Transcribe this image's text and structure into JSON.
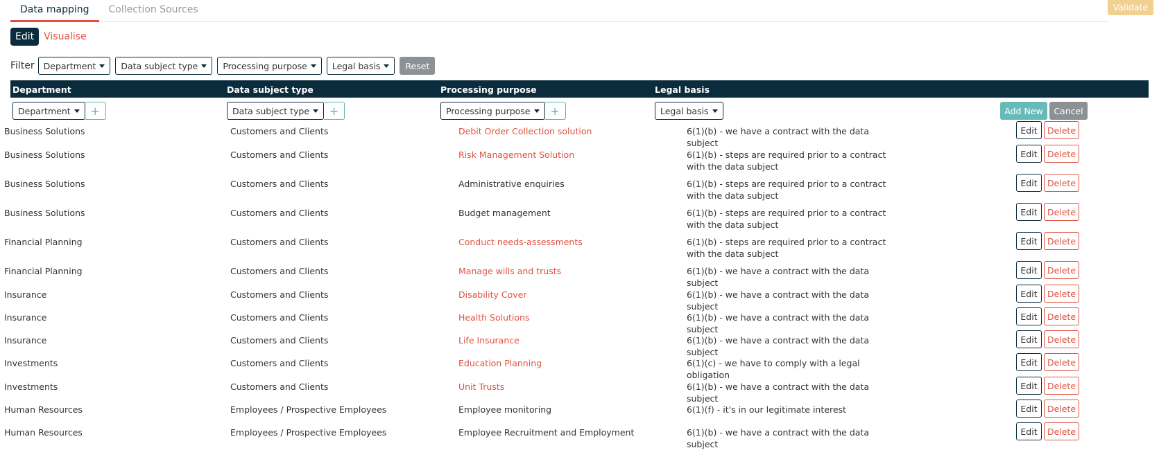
{
  "tabs": [
    {
      "label": "Data mapping",
      "active": true
    },
    {
      "label": "Collection Sources",
      "active": false
    }
  ],
  "validate_label": "Validate",
  "mode": {
    "edit": "Edit",
    "visualise": "Visualise"
  },
  "filter": {
    "label": "Filter",
    "dropdowns": [
      "Department",
      "Data subject type",
      "Processing purpose",
      "Legal basis"
    ],
    "reset": "Reset"
  },
  "table": {
    "headers": [
      "Department",
      "Data subject type",
      "Processing purpose",
      "Legal basis"
    ],
    "add_row": {
      "department": "Department",
      "subject_type": "Data subject type",
      "purpose": "Processing purpose",
      "legal_basis": "Legal basis",
      "plus": "+",
      "add_new": "Add New",
      "cancel": "Cancel"
    },
    "row_actions": {
      "edit": "Edit",
      "delete": "Delete"
    },
    "rows": [
      {
        "department": "Business Solutions",
        "subject_type": "Customers and Clients",
        "purpose": "Debit Order Collection solution",
        "purpose_link": true,
        "legal_basis": "6(1)(b) - we have a contract with the data subject"
      },
      {
        "department": "Business Solutions",
        "subject_type": "Customers and Clients",
        "purpose": "Risk Management Solution",
        "purpose_link": true,
        "legal_basis": "6(1)(b) - steps are required prior to a contract with the data subject"
      },
      {
        "department": "Business Solutions",
        "subject_type": "Customers and Clients",
        "purpose": "Administrative enquiries",
        "purpose_link": false,
        "legal_basis": "6(1)(b) - steps are required prior to a contract with the data subject"
      },
      {
        "department": "Business Solutions",
        "subject_type": "Customers and Clients",
        "purpose": "Budget management",
        "purpose_link": false,
        "legal_basis": "6(1)(b) - steps are required prior to a contract with the data subject"
      },
      {
        "department": "Financial Planning",
        "subject_type": "Customers and Clients",
        "purpose": "Conduct needs-assessments",
        "purpose_link": true,
        "legal_basis": "6(1)(b) - steps are required prior to a contract with the data subject"
      },
      {
        "department": "Financial Planning",
        "subject_type": "Customers and Clients",
        "purpose": "Manage wills and trusts",
        "purpose_link": true,
        "legal_basis": "6(1)(b) - we have a contract with the data subject"
      },
      {
        "department": "Insurance",
        "subject_type": "Customers and Clients",
        "purpose": "Disability Cover",
        "purpose_link": true,
        "legal_basis": "6(1)(b) - we have a contract with the data subject"
      },
      {
        "department": "Insurance",
        "subject_type": "Customers and Clients",
        "purpose": "Health Solutions",
        "purpose_link": true,
        "legal_basis": "6(1)(b) - we have a contract with the data subject"
      },
      {
        "department": "Insurance",
        "subject_type": "Customers and Clients",
        "purpose": "Life Insurance",
        "purpose_link": true,
        "legal_basis": "6(1)(b) - we have a contract with the data subject"
      },
      {
        "department": "Investments",
        "subject_type": "Customers and Clients",
        "purpose": "Education Planning",
        "purpose_link": true,
        "legal_basis": "6(1)(c) - we have to comply with a legal obligation"
      },
      {
        "department": "Investments",
        "subject_type": "Customers and Clients",
        "purpose": "Unit Trusts",
        "purpose_link": true,
        "legal_basis": "6(1)(b) - we have a contract with the data subject"
      },
      {
        "department": "Human Resources",
        "subject_type": "Employees / Prospective Employees",
        "purpose": "Employee monitoring",
        "purpose_link": false,
        "legal_basis": "6(1)(f) - it's in our legitimate interest"
      },
      {
        "department": "Human Resources",
        "subject_type": "Employees / Prospective Employees",
        "purpose": "Employee Recruitment and Employment",
        "purpose_link": false,
        "legal_basis": "6(1)(b) - we have a contract with the data subject"
      }
    ]
  },
  "colors": {
    "navy": "#0b2c3d",
    "accent_red": "#e0523f",
    "teal": "#66bbb8",
    "gray": "#8c9196",
    "validate": "#f2d08f"
  }
}
